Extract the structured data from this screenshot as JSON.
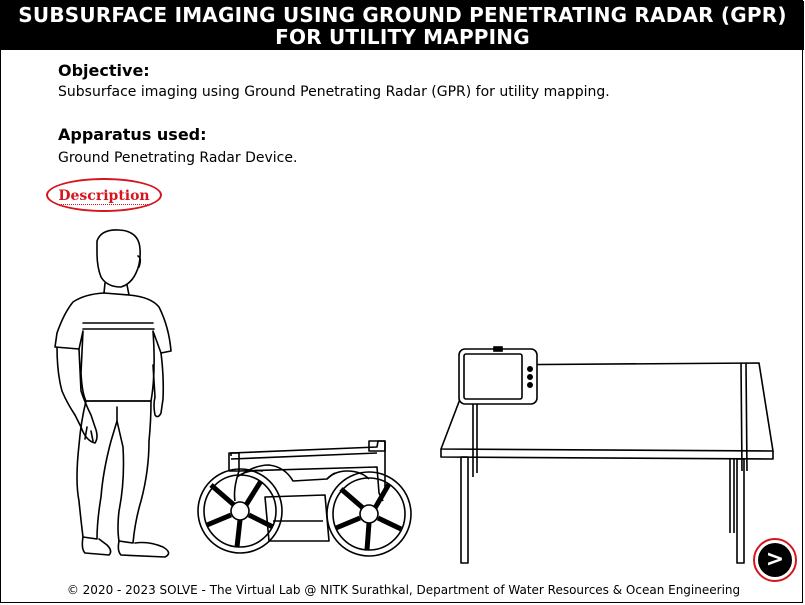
{
  "page": {
    "title": "SUBSURFACE IMAGING USING GROUND PENETRATING RADAR (GPR) FOR UTILITY MAPPING"
  },
  "objective": {
    "heading": "Objective:",
    "text": "Subsurface imaging using Ground Penetrating Radar (GPR) for utility mapping."
  },
  "apparatus": {
    "heading": "Apparatus used:",
    "text": "Ground Penetrating Radar Device."
  },
  "description_link": {
    "label": "Description"
  },
  "next_button": {
    "glyph": ">",
    "icon": "next-arrow-icon"
  },
  "footer": {
    "text": "© 2020 - 2023 SOLVE - The Virtual Lab @ NITK Surathkal, Department of Water Resources & Ocean Engineering"
  },
  "colors": {
    "accent": "#d4161d",
    "title_bg": "#000000",
    "title_fg": "#ffffff"
  }
}
